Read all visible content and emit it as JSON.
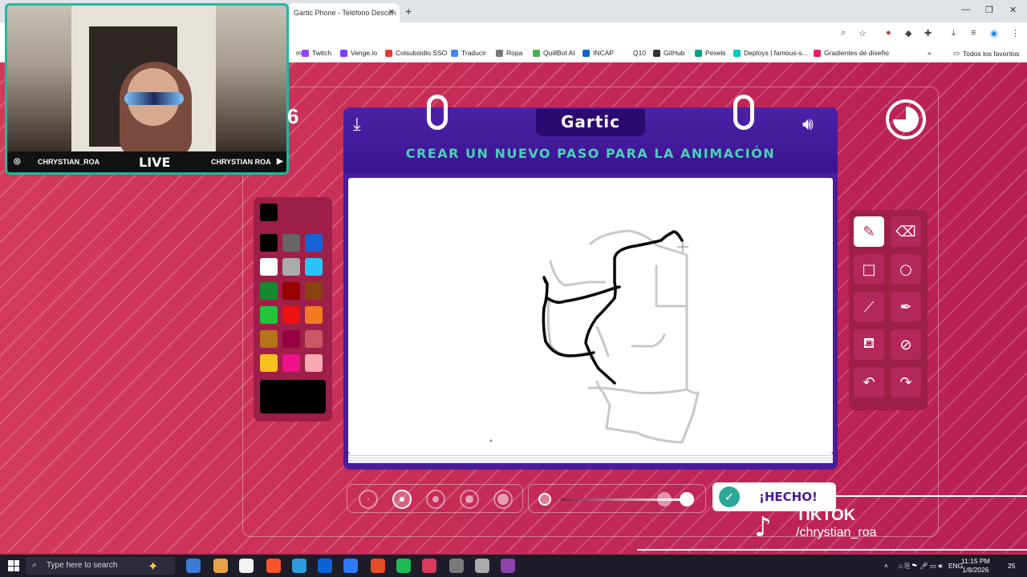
{
  "browser": {
    "tab_title": "Gartic Phone - Teléfono Descon",
    "tab_close": "✕",
    "new_tab": "+",
    "window_controls": [
      "—",
      "❐",
      "✕"
    ],
    "omnibar_icons": [
      "zoom-icon",
      "star-icon",
      "extension-icon",
      "download-icon",
      "menu-icon"
    ],
    "bookmarks": [
      {
        "label": "m",
        "color": "#ffffff"
      },
      {
        "label": "Twitch",
        "color": "#9146ff"
      },
      {
        "label": "Venge.io",
        "color": "#7a3cff"
      },
      {
        "label": "Colsubsidio SSO",
        "color": "#e23b2e"
      },
      {
        "label": "Traducir",
        "color": "#4285f4"
      },
      {
        "label": "Ropa",
        "color": "#777777"
      },
      {
        "label": "QuillBot AI",
        "color": "#4caf50"
      },
      {
        "label": "INCAP",
        "color": "#1565c0"
      },
      {
        "label": "Q10",
        "color": "#ffffff"
      },
      {
        "label": "GitHub",
        "color": "#333333"
      },
      {
        "label": "Pexels",
        "color": "#05a081"
      },
      {
        "label": "Deploys | famous-s...",
        "color": "#00c7b7"
      },
      {
        "label": "Gradientes de diseño",
        "color": "#e91e63"
      }
    ],
    "more_bookmarks": "»",
    "all_bookmarks": "Todos los favoritos"
  },
  "stream": {
    "left_name": "CHRYSTIAN_ROA",
    "live_label": "LIVE",
    "right_name": "CHRYSTIAN ROA"
  },
  "game": {
    "round_number": "6",
    "logo": "Gartic",
    "task": "CREAR UN NUEVO PASO PARA LA ANIMACIÓN",
    "done_label": "¡HECHO!",
    "timer_remaining_fraction": 0.75,
    "palette": {
      "selected_color": "#000000",
      "colors": [
        "#000000",
        "#666666",
        "#1565d8",
        "#ffffff",
        "#aaaaaa",
        "#29c4f6",
        "#168a2e",
        "#990000",
        "#8a4210",
        "#22c43a",
        "#ee1111",
        "#f37a22",
        "#b8741c",
        "#990044",
        "#cc5566",
        "#f8c020",
        "#ee1188",
        "#f8a8b0"
      ]
    },
    "tools": [
      {
        "name": "pencil-tool",
        "glyph": "✎",
        "active": true
      },
      {
        "name": "eraser-tool",
        "glyph": "⌫",
        "active": false
      },
      {
        "name": "rectangle-tool",
        "glyph": "□",
        "active": false
      },
      {
        "name": "ellipse-tool",
        "glyph": "○",
        "active": false
      },
      {
        "name": "line-tool",
        "glyph": "⟋",
        "active": false
      },
      {
        "name": "eyedropper-tool",
        "glyph": "✒",
        "active": false
      },
      {
        "name": "fill-tool",
        "glyph": "⛾",
        "active": false
      },
      {
        "name": "clear-tool",
        "glyph": "⊘",
        "active": false
      },
      {
        "name": "undo-tool",
        "glyph": "↶",
        "active": false
      },
      {
        "name": "redo-tool",
        "glyph": "↷",
        "active": false
      }
    ],
    "brush_sizes_selected_index": 1,
    "brush_size_count": 5,
    "opacity_selected_index": 1
  },
  "tiktok": {
    "brand": "TIKTOK",
    "handle": "/chrystian_roa"
  },
  "taskbar": {
    "search_placeholder": "Type here to search",
    "language": "ENG",
    "time": "11:15 PM",
    "date": "1/8/2026",
    "notification_count": "25",
    "apps": [
      "#f2c94c",
      "#3a7bd5",
      "#e8a24a",
      "#f2f2f2",
      "#fb542b",
      "#2d9cdb",
      "#0a64d8",
      "#2f7bff",
      "#e34c26",
      "#1db954",
      "#d63b5c",
      "#7a7a7a",
      "#aaaaaa",
      "#8e44ad"
    ]
  }
}
